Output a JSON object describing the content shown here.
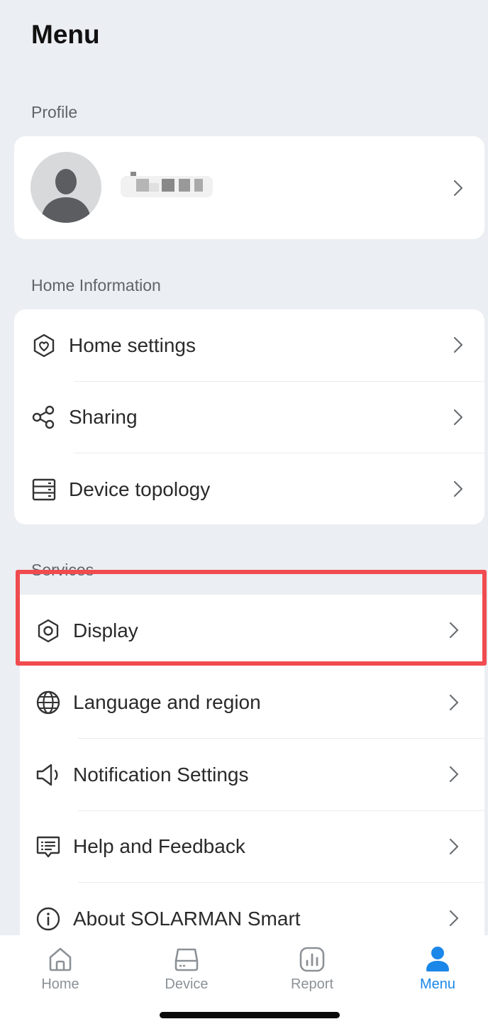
{
  "page": {
    "title": "Menu"
  },
  "profile": {
    "section_label": "Profile"
  },
  "home_information": {
    "section_label": "Home Information",
    "items": [
      {
        "label": "Home settings",
        "icon": "home-shield-icon"
      },
      {
        "label": "Sharing",
        "icon": "share-icon"
      },
      {
        "label": "Device topology",
        "icon": "server-icon"
      }
    ]
  },
  "services": {
    "section_label": "Services",
    "items": [
      {
        "label": "Display",
        "icon": "hexagon-gear-icon"
      },
      {
        "label": "Language and region",
        "icon": "globe-icon"
      },
      {
        "label": "Notification Settings",
        "icon": "speaker-icon"
      },
      {
        "label": "Help and Feedback",
        "icon": "message-icon"
      },
      {
        "label": "About SOLARMAN Smart",
        "icon": "info-icon"
      }
    ]
  },
  "tabbar": {
    "items": [
      {
        "label": "Home",
        "icon": "home-icon",
        "active": false
      },
      {
        "label": "Device",
        "icon": "device-icon",
        "active": false
      },
      {
        "label": "Report",
        "icon": "report-icon",
        "active": false
      },
      {
        "label": "Menu",
        "icon": "user-icon",
        "active": true
      }
    ]
  },
  "colors": {
    "accent": "#1b87e8",
    "highlight": "#f04b4f",
    "background": "#ebeef2"
  }
}
